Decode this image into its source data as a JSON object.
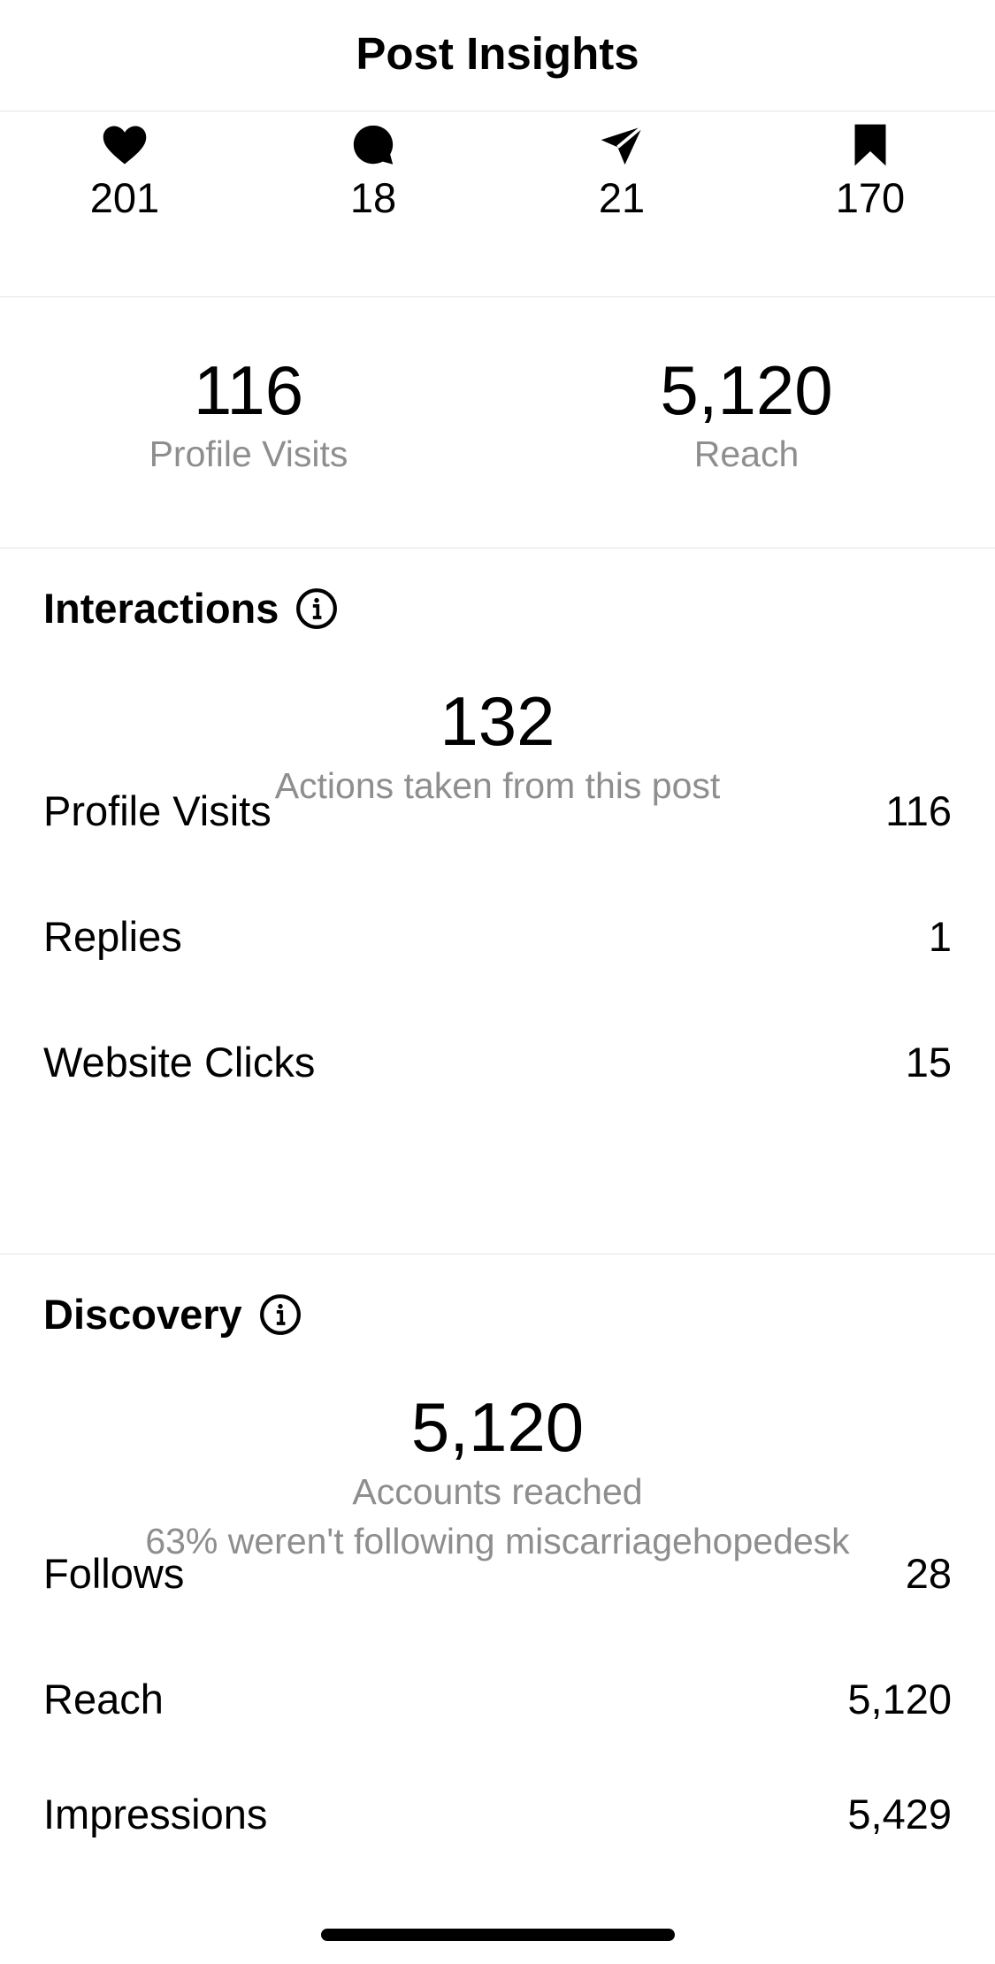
{
  "header": {
    "title": "Post Insights"
  },
  "engagement": [
    {
      "icon": "heart-icon",
      "value": "201"
    },
    {
      "icon": "comment-icon",
      "value": "18"
    },
    {
      "icon": "share-icon",
      "value": "21"
    },
    {
      "icon": "bookmark-icon",
      "value": "170"
    }
  ],
  "summary": {
    "profile_visits": {
      "value": "116",
      "label": "Profile Visits"
    },
    "reach": {
      "value": "5,120",
      "label": "Reach"
    }
  },
  "interactions": {
    "title": "Interactions",
    "total_value": "132",
    "total_label": "Actions taken from this post",
    "rows": [
      {
        "label": "Profile Visits",
        "value": "116"
      },
      {
        "label": "Replies",
        "value": "1"
      },
      {
        "label": "Website Clicks",
        "value": "15"
      }
    ]
  },
  "discovery": {
    "title": "Discovery",
    "total_value": "5,120",
    "total_label": "Accounts reached",
    "subtext": "63% weren't following miscarriagehopedesk",
    "rows": [
      {
        "label": "Follows",
        "value": "28"
      },
      {
        "label": "Reach",
        "value": "5,120"
      },
      {
        "label": "Impressions",
        "value": "5,429"
      }
    ]
  }
}
